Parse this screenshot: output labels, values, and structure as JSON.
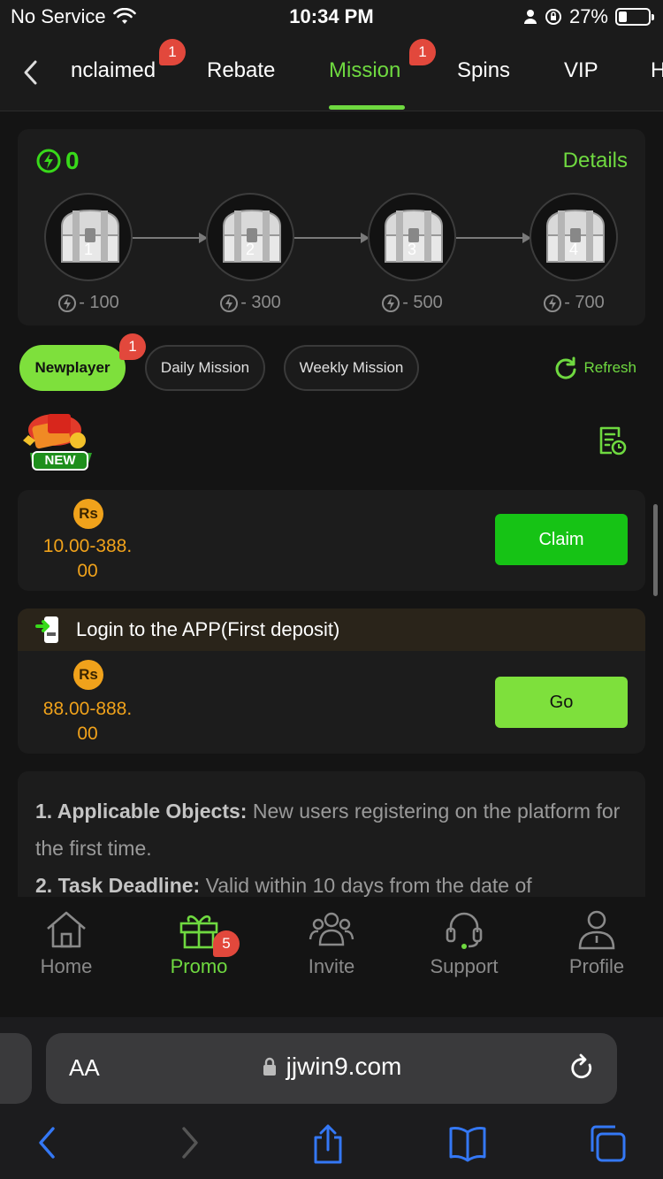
{
  "status": {
    "carrier": "No Service",
    "time": "10:34 PM",
    "battery": "27%",
    "battery_level": 0.27
  },
  "tabs": [
    {
      "label": "nclaimed",
      "badge": "1"
    },
    {
      "label": "Rebate"
    },
    {
      "label": "Mission",
      "badge": "1",
      "active": true
    },
    {
      "label": "Spins"
    },
    {
      "label": "VIP"
    },
    {
      "label": "H"
    }
  ],
  "points": {
    "value": "0",
    "details_label": "Details",
    "chests": [
      {
        "num": "1",
        "cost": "- 100"
      },
      {
        "num": "2",
        "cost": "- 300"
      },
      {
        "num": "3",
        "cost": "- 500"
      },
      {
        "num": "4",
        "cost": "- 700"
      }
    ]
  },
  "filters": {
    "newplayer": "Newplayer",
    "newplayer_badge": "1",
    "daily": "Daily Mission",
    "weekly": "Weekly Mission",
    "refresh": "Refresh"
  },
  "new_label": "NEW",
  "missions": [
    {
      "currency": "Rs",
      "reward_line1": "10.00-388.",
      "reward_line2": "00",
      "action": "Claim"
    },
    {
      "title": "Login to the APP(First deposit)",
      "currency": "Rs",
      "reward_line1": "88.00-888.",
      "reward_line2": "00",
      "action": "Go"
    }
  ],
  "rules": [
    {
      "head": "1. Applicable Objects:",
      "text": " New users registering on the platform for the first time."
    },
    {
      "head": "2. Task Deadline:",
      "text": " Valid within 10 days from the date of"
    }
  ],
  "nav": [
    {
      "label": "Home",
      "icon": "home-icon"
    },
    {
      "label": "Promo",
      "icon": "gift-icon",
      "badge": "5",
      "active": true
    },
    {
      "label": "Invite",
      "icon": "invite-icon"
    },
    {
      "label": "Support",
      "icon": "headset-icon"
    },
    {
      "label": "Profile",
      "icon": "profile-icon"
    }
  ],
  "safari": {
    "aa": "AA",
    "url": "jjwin9.com"
  },
  "colors": {
    "accent": "#6fd940",
    "claim": "#16c315",
    "coin": "#f0a21b",
    "badge": "#e2483c"
  }
}
